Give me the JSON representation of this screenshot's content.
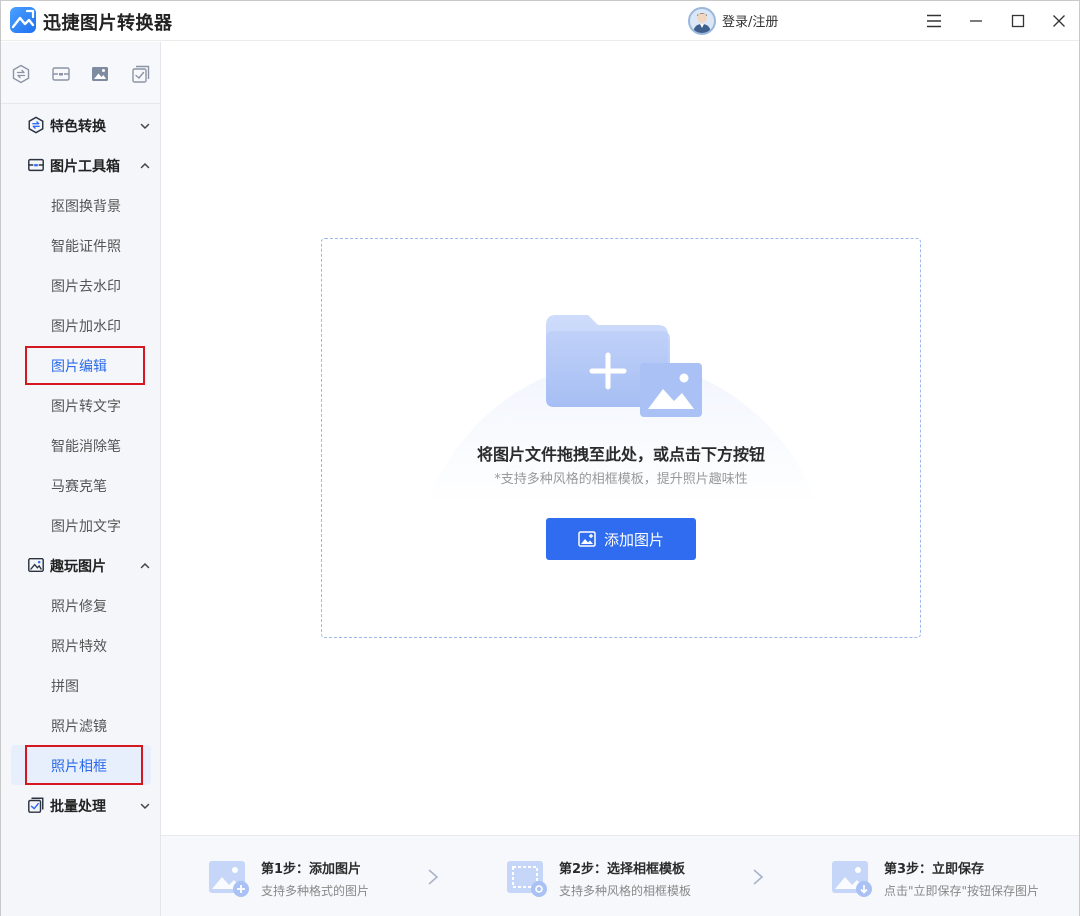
{
  "app": {
    "title": "迅捷图片转换器",
    "login_label": "登录/注册"
  },
  "window_controls": [
    "menu-icon",
    "minimize-icon",
    "maximize-icon",
    "close-icon"
  ],
  "sidebar": {
    "top_tabs": [
      "format-convert-icon",
      "toolbox-icon",
      "image-fun-icon",
      "batch-icon"
    ],
    "sections": [
      {
        "label": "特色转换",
        "icon": "format-convert-icon",
        "expanded": false
      },
      {
        "label": "图片工具箱",
        "icon": "toolbox-icon",
        "expanded": true
      },
      {
        "label": "趣玩图片",
        "icon": "image-fun-icon",
        "expanded": true
      },
      {
        "label": "批量处理",
        "icon": "batch-icon",
        "expanded": false
      }
    ],
    "toolbox_items": [
      "抠图换背景",
      "智能证件照",
      "图片去水印",
      "图片加水印",
      "图片编辑",
      "图片转文字",
      "智能消除笔",
      "马赛克笔",
      "图片加文字"
    ],
    "fun_items": [
      "照片修复",
      "照片特效",
      "拼图",
      "照片滤镜",
      "照片相框"
    ],
    "active_item": "照片相框"
  },
  "dropzone": {
    "title": "将图片文件拖拽至此处，或点击下方按钮",
    "subtitle": "*支持多种风格的相框模板，提升照片趣味性",
    "button_label": "添加图片"
  },
  "steps": [
    {
      "title": "第1步：添加图片",
      "desc": "支持多种格式的图片"
    },
    {
      "title": "第2步：选择相框模板",
      "desc": "支持多种风格的相框模板"
    },
    {
      "title": "第3步：立即保存",
      "desc": "点击\"立即保存\"按钮保存图片"
    }
  ],
  "colors": {
    "accent": "#2f6cf0",
    "active_bg": "#e7eefc",
    "highlight_box": "#d3191f"
  }
}
